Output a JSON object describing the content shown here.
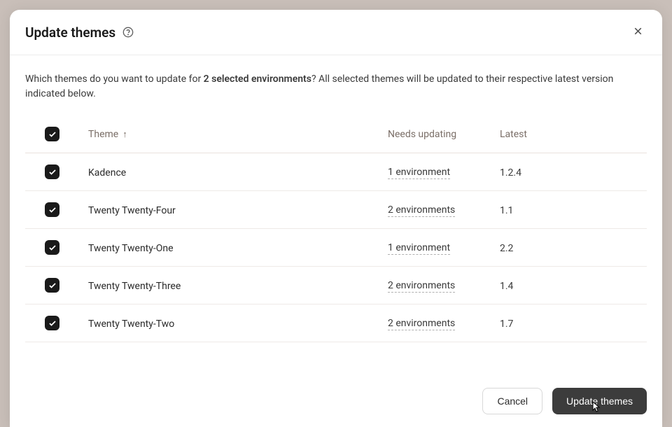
{
  "modal": {
    "title": "Update themes",
    "description_prefix": "Which themes do you want to update for ",
    "description_bold": "2 selected environments",
    "description_suffix": "? All selected themes will be updated to their respective latest version indicated below."
  },
  "table": {
    "headers": {
      "theme": "Theme",
      "needs_updating": "Needs updating",
      "latest": "Latest"
    },
    "rows": [
      {
        "name": "Kadence",
        "envs": "1 environment",
        "latest": "1.2.4"
      },
      {
        "name": "Twenty Twenty-Four",
        "envs": "2 environments",
        "latest": "1.1"
      },
      {
        "name": "Twenty Twenty-One",
        "envs": "1 environment",
        "latest": "2.2"
      },
      {
        "name": "Twenty Twenty-Three",
        "envs": "2 environments",
        "latest": "1.4"
      },
      {
        "name": "Twenty Twenty-Two",
        "envs": "2 environments",
        "latest": "1.7"
      }
    ]
  },
  "footer": {
    "cancel": "Cancel",
    "confirm": "Update themes"
  }
}
